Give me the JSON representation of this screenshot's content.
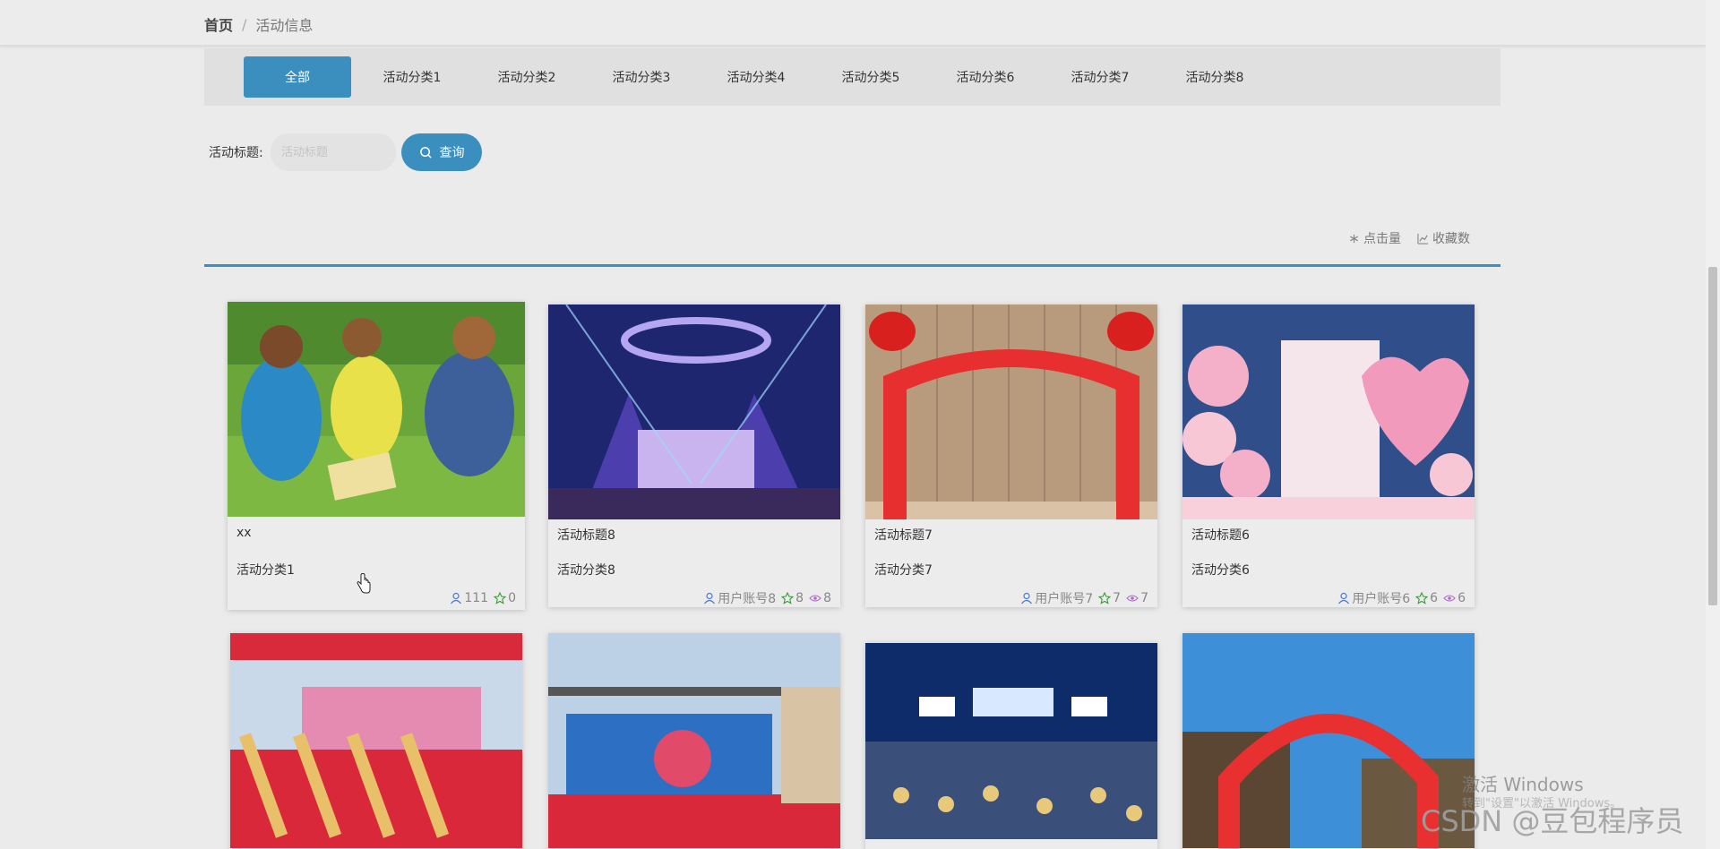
{
  "breadcrumb": {
    "home": "首页",
    "separator": "/",
    "current": "活动信息"
  },
  "categories": [
    "全部",
    "活动分类1",
    "活动分类2",
    "活动分类3",
    "活动分类4",
    "活动分类5",
    "活动分类6",
    "活动分类7",
    "活动分类8"
  ],
  "active_category_index": 0,
  "search": {
    "label": "活动标题:",
    "placeholder": "活动标题",
    "button": "查询"
  },
  "sort": {
    "clicks": "点击量",
    "favorites": "收藏数"
  },
  "cards": [
    {
      "title": "xx",
      "category": "活动分类1",
      "user": "",
      "clicks": "111",
      "stars": "0",
      "views": ""
    },
    {
      "title": "活动标题8",
      "category": "活动分类8",
      "user": "用户账号8",
      "stars": "8",
      "views": "8"
    },
    {
      "title": "活动标题7",
      "category": "活动分类7",
      "user": "用户账号7",
      "stars": "7",
      "views": "7"
    },
    {
      "title": "活动标题6",
      "category": "活动分类6",
      "user": "用户账号6",
      "stars": "6",
      "views": "6"
    }
  ],
  "watermarks": {
    "windows_line1": "激活 Windows",
    "windows_line2": "转到\"设置\"以激活 Windows。",
    "csdn": "CSDN @豆包程序员"
  },
  "colors": {
    "accent": "#3a8fbf",
    "page_bg": "#ebebeb",
    "strip_bg": "#e0e0e0"
  }
}
